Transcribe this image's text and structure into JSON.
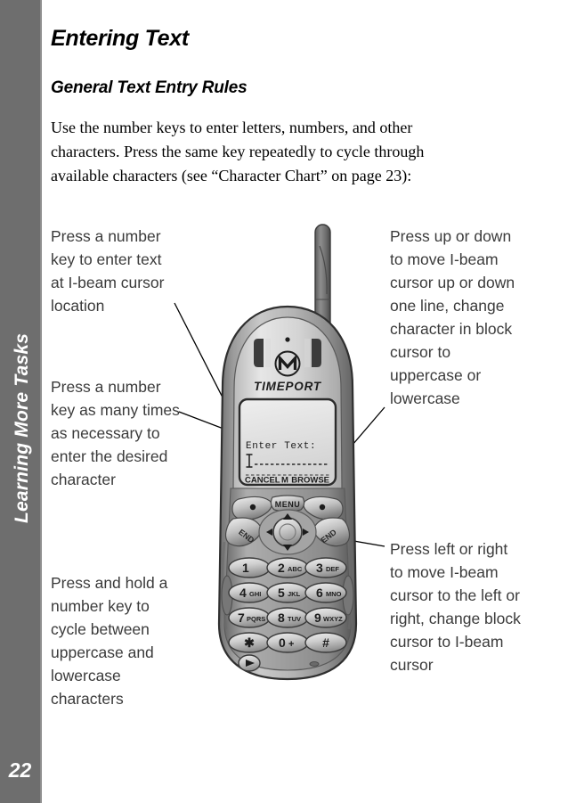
{
  "sidebar": {
    "chapter_title": "Learning More Tasks",
    "page_number": "22",
    "background_color": "#6e6e6e",
    "text_color": "#ffffff"
  },
  "page": {
    "heading": "Entering Text",
    "subheading": "General Text Entry Rules",
    "intro_paragraph": "Use the number keys to enter letters, numbers, and other characters. Press the same key repeatedly to cycle through available characters (see “Character Chart” on page 23):"
  },
  "callouts": {
    "left": [
      "Press a number key to enter text at I-beam cursor location",
      "Press a number key as many times as necessary to enter the desired character",
      "Press and hold a number key to cycle between uppercase and lowercase characters"
    ],
    "right": [
      "Press up or down to move I-beam cursor up or down one line, change character in block cursor to uppercase or lowercase",
      "Press left or right to move I-beam cursor to the left or right, change block cursor to I-beam cursor"
    ]
  },
  "phone": {
    "brand_logo": "motorola-m-logo",
    "model_name": "TIMEPORT",
    "display": {
      "prompt": "Enter Text:",
      "cursor": "I-beam",
      "entry_line_1": "- - - - - - - - - - - - - - -",
      "entry_line_2": "- - - - - - - - - - - - - - -",
      "softkeys": [
        "CANCEL",
        "M",
        "BROWSE"
      ]
    },
    "navigation": {
      "menu_label": "MENU",
      "left_end_label": "END",
      "right_end_label": "END",
      "dpad_directions": [
        "up",
        "down",
        "left",
        "right"
      ]
    },
    "keypad": [
      {
        "digit": "1",
        "letters": ""
      },
      {
        "digit": "2",
        "letters": "ABC"
      },
      {
        "digit": "3",
        "letters": "DEF"
      },
      {
        "digit": "4",
        "letters": "GHI"
      },
      {
        "digit": "5",
        "letters": "JKL"
      },
      {
        "digit": "6",
        "letters": "MNO"
      },
      {
        "digit": "7",
        "letters": "PQRS"
      },
      {
        "digit": "8",
        "letters": "TUV"
      },
      {
        "digit": "9",
        "letters": "WXYZ"
      },
      {
        "digit": "✱",
        "letters": ""
      },
      {
        "digit": "0",
        "letters": "+"
      },
      {
        "digit": "#",
        "letters": ""
      }
    ],
    "voice_button": "play-triangle-icon"
  }
}
